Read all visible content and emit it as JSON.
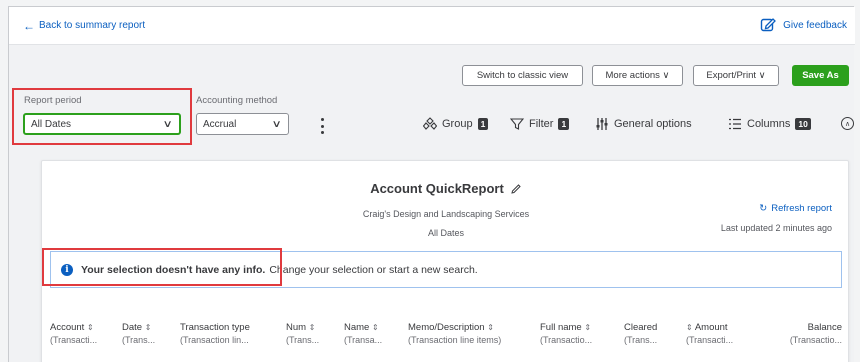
{
  "header": {
    "back_label": "Back to summary report",
    "feedback_label": "Give feedback"
  },
  "toolbar": {
    "switch_label": "Switch to classic view",
    "more_label": "More actions ∨",
    "export_label": "Export/Print ∨",
    "save_label": "Save As"
  },
  "filters": {
    "report_period_label": "Report period",
    "report_period_value": "All Dates",
    "accounting_method_label": "Accounting method",
    "accounting_method_value": "Accrual"
  },
  "options": {
    "group_label": "Group",
    "group_count": "1",
    "filter_label": "Filter",
    "filter_count": "1",
    "general_label": "General options",
    "columns_label": "Columns",
    "columns_count": "10"
  },
  "report": {
    "title": "Account QuickReport",
    "company": "Craig's Design and Landscaping Services",
    "period": "All Dates",
    "refresh_label": "Refresh report",
    "last_updated": "Last updated 2 minutes ago",
    "info_bold": "Your selection doesn't have any info.",
    "info_rest": "Change your selection or start a new search."
  },
  "columns": [
    {
      "label": "Account",
      "sub": "(Transacti..."
    },
    {
      "label": "Date",
      "sub": "(Trans..."
    },
    {
      "label": "Transaction type",
      "sub": "(Transaction lin..."
    },
    {
      "label": "Num",
      "sub": "(Trans..."
    },
    {
      "label": "Name",
      "sub": "(Transa..."
    },
    {
      "label": "Memo/Description",
      "sub": "(Transaction line items)"
    },
    {
      "label": "Full name",
      "sub": "(Transactio..."
    },
    {
      "label": "Cleared",
      "sub": "(Trans..."
    },
    {
      "label": "Amount",
      "sub": "(Transacti..."
    },
    {
      "label": "Balance",
      "sub": "(Transactio..."
    }
  ],
  "colors": {
    "accent": "#0b5fc0",
    "save_green": "#2ca01c",
    "highlight_red": "#e03a3e"
  }
}
